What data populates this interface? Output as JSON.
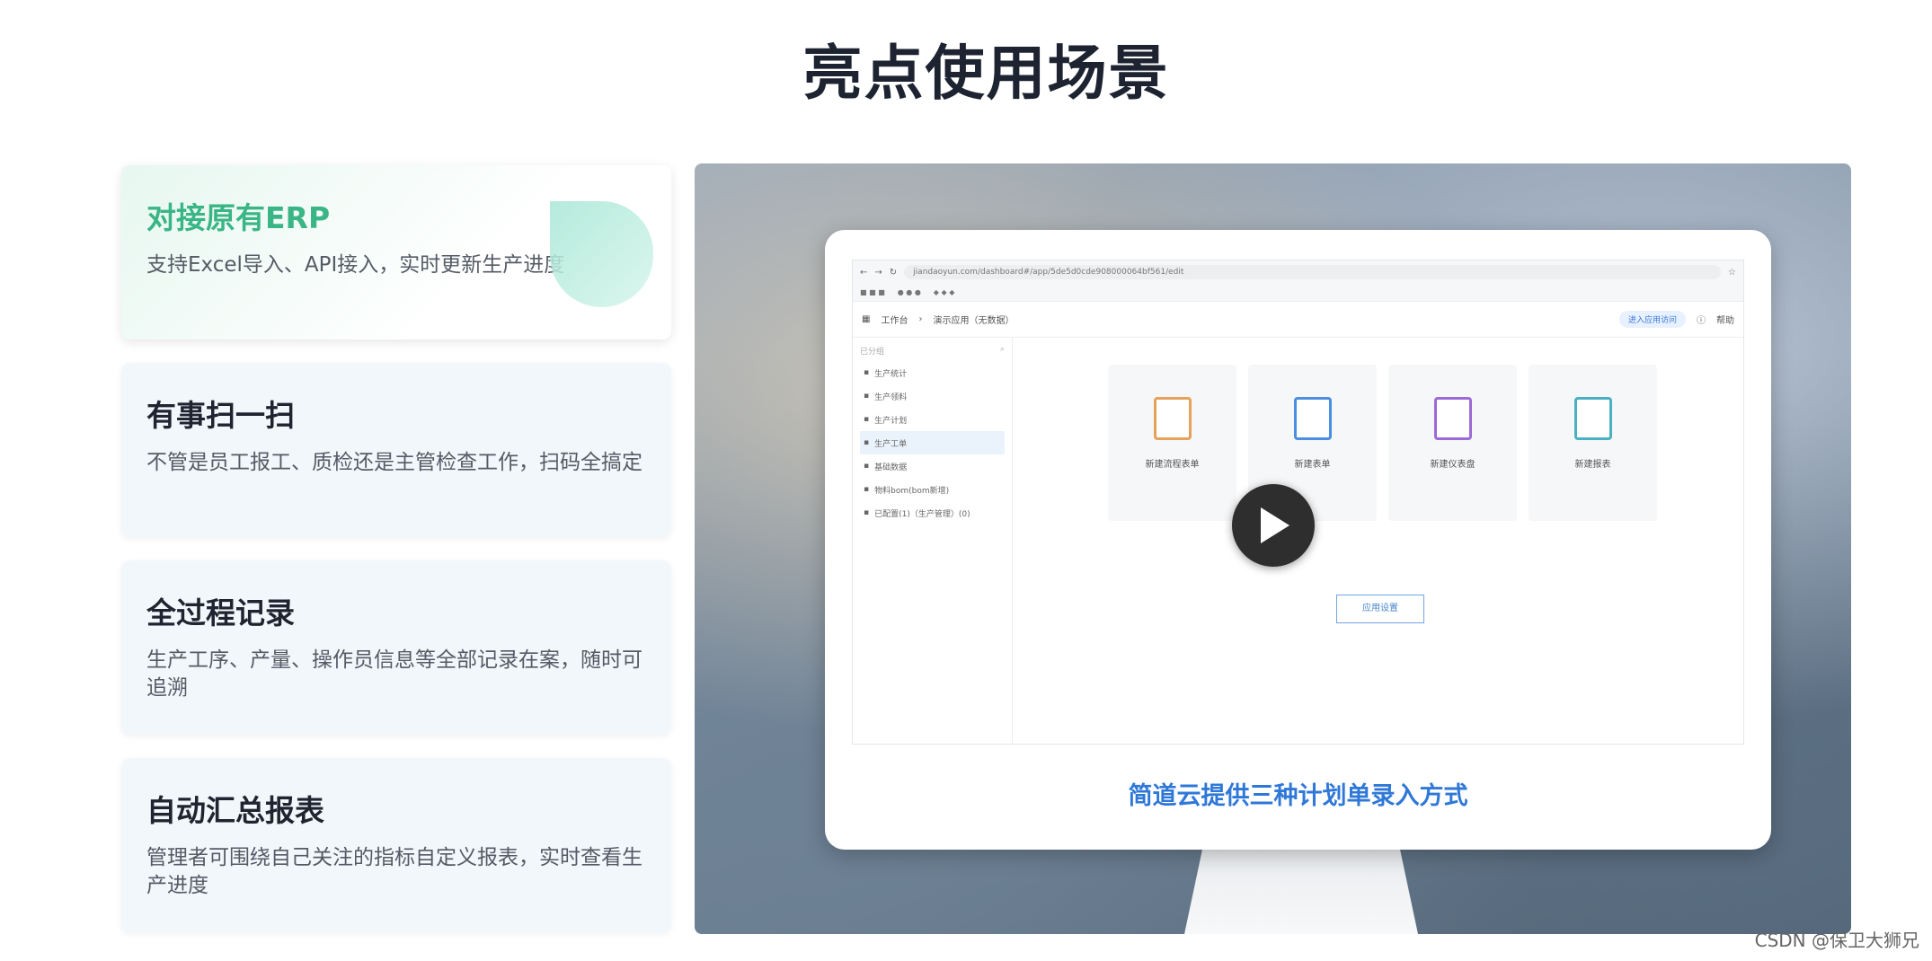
{
  "page_title": "亮点使用场景",
  "features": [
    {
      "title": "对接原有ERP",
      "desc": "支持Excel导入、API接入，实时更新生产进度"
    },
    {
      "title": "有事扫一扫",
      "desc": "不管是员工报工、质检还是主管检查工作，扫码全搞定"
    },
    {
      "title": "全过程记录",
      "desc": "生产工序、产量、操作员信息等全部记录在案，随时可追溯"
    },
    {
      "title": "自动汇总报表",
      "desc": "管理者可围绕自己关注的指标自定义报表，实时查看生产进度"
    }
  ],
  "video": {
    "caption": "简道云提供三种计划单录入方式",
    "browser_url": "jiandaoyun.com/dashboard#/app/5de5d0cde908000064bf561/edit",
    "breadcrumb": [
      "工作台",
      "演示应用（无数据）"
    ],
    "header_action": "进入应用访问",
    "help_label": "帮助",
    "sidebar_search_placeholder": "已分组",
    "sidebar_items": [
      "生产统计",
      "生产领料",
      "生产计划",
      "生产工单",
      "基础数据",
      "物料bom(bom新增)",
      "已配置(1)（生产管理）(0)"
    ],
    "tiles": [
      {
        "label": "新建流程表单",
        "color": "#e6a15a"
      },
      {
        "label": "新建表单",
        "color": "#4a8fe0"
      },
      {
        "label": "新建仪表盘",
        "color": "#9b6ad8"
      },
      {
        "label": "新建报表",
        "color": "#4ab0c4"
      }
    ],
    "settings_button": "应用设置"
  },
  "watermark": "CSDN @保卫大狮兄"
}
